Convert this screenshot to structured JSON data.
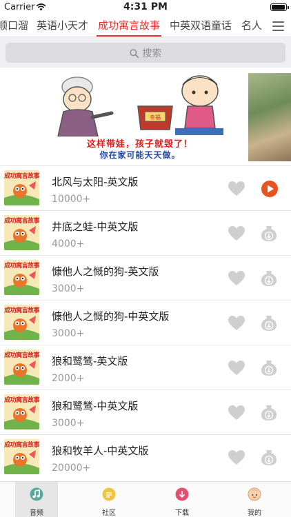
{
  "status_bar": {
    "carrier": "Carrier",
    "time": "4:31 PM"
  },
  "tabs": {
    "items": [
      {
        "label": "顺口溜"
      },
      {
        "label": "英语小天才"
      },
      {
        "label": "成功寓言故事",
        "active": true
      },
      {
        "label": "中英双语童话"
      },
      {
        "label": "名人"
      }
    ],
    "active_color": "#e8322f"
  },
  "search": {
    "placeholder": "搜索"
  },
  "banner": {
    "caption_line1": "这样带娃，孩子就毁了！",
    "caption_line2": "你在家可能天天做。",
    "pot_label": "幸福"
  },
  "list": {
    "thumb_text": "成功寓言故事",
    "items": [
      {
        "title": "北风与太阳-英文版",
        "plays": "10000+",
        "state": "playing"
      },
      {
        "title": "井底之蛙-中英文版",
        "plays": "4000+",
        "state": "download"
      },
      {
        "title": "慷他人之慨的狗-英文版",
        "plays": "3000+",
        "state": "download"
      },
      {
        "title": "慷他人之慨的狗-中英文版",
        "plays": "3000+",
        "state": "download"
      },
      {
        "title": "狼和鹭鸶-英文版",
        "plays": "2000+",
        "state": "download"
      },
      {
        "title": "狼和鹭鸶-中英文版",
        "plays": "3000+",
        "state": "download"
      },
      {
        "title": "狼和牧羊人-中英文版",
        "plays": "20000+",
        "state": "download"
      }
    ]
  },
  "tabbar": {
    "items": [
      {
        "label": "音频",
        "icon": "music-note-icon",
        "active": true
      },
      {
        "label": "社区",
        "icon": "chat-bubble-icon"
      },
      {
        "label": "下载",
        "icon": "download-icon"
      },
      {
        "label": "我的",
        "icon": "baby-face-icon"
      }
    ]
  },
  "colors": {
    "accent": "#e8322f",
    "play": "#e8531f",
    "icon_gray": "#cfcfcf"
  }
}
